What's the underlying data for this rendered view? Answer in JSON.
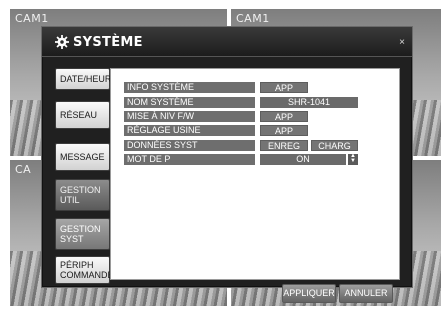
{
  "cameras": [
    {
      "label": "CAM1"
    },
    {
      "label": "CAM1"
    },
    {
      "label": "CA"
    },
    {
      "label": ""
    }
  ],
  "dialog": {
    "title": "SYSTÈME",
    "close_label": "×"
  },
  "sidebar": {
    "items": [
      {
        "label": "DATE/HEURE"
      },
      {
        "label": "RÉSEAU"
      },
      {
        "label": "MESSAGE"
      },
      {
        "label": "GESTION UTIL"
      },
      {
        "label": "GESTION SYST"
      },
      {
        "label": "PÉRIPH COMMANDE"
      }
    ]
  },
  "settings": {
    "info_systeme": {
      "label": "INFO SYSTÈME",
      "button": "APP"
    },
    "nom_systeme": {
      "label": "NOM SYSTÈME",
      "value": "SHR-1041"
    },
    "mise_a_niv": {
      "label": "MISE À NIV F/W",
      "button": "APP"
    },
    "reglage_usine": {
      "label": "RÉGLAGE USINE",
      "button": "APP"
    },
    "donnees_syst": {
      "label": "DONNÉES SYST",
      "save_button": "ENREG",
      "load_button": "CHARG"
    },
    "mot_de_p": {
      "label": "MOT DE P",
      "value": "ON"
    }
  },
  "footer": {
    "apply_label": "APPLIQUER",
    "cancel_label": "ANNULER"
  }
}
